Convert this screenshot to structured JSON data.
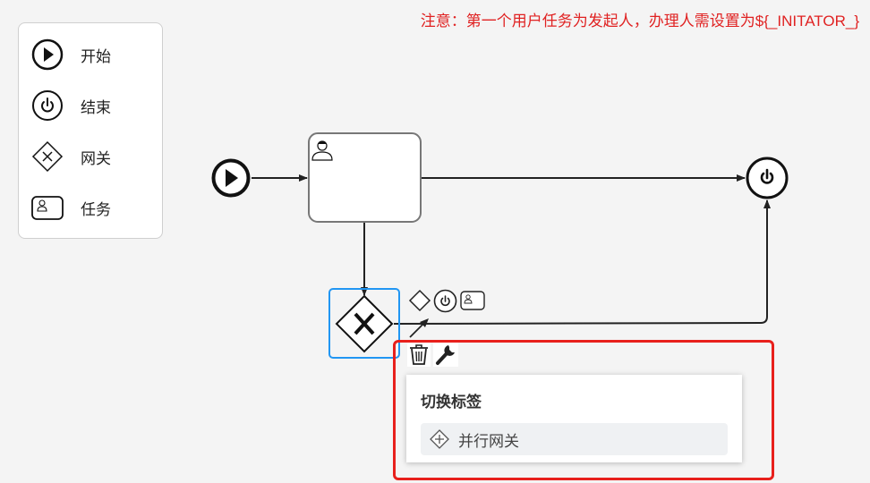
{
  "notice": "注意：第一个用户任务为发起人，办理人需设置为${_INITATOR_}",
  "palette": {
    "items": [
      {
        "label": "开始",
        "icon": "start-event-icon"
      },
      {
        "label": "结束",
        "icon": "end-event-icon"
      },
      {
        "label": "网关",
        "icon": "exclusive-gateway-icon"
      },
      {
        "label": "任务",
        "icon": "user-task-icon"
      }
    ]
  },
  "context_pad": {
    "icons": [
      "append-gateway-icon",
      "append-end-event-icon",
      "append-task-icon",
      "connect-arrow-icon",
      "delete-trash-icon",
      "change-type-wrench-icon"
    ]
  },
  "popup": {
    "title": "切换标签",
    "entries": [
      {
        "label": "并行网关",
        "icon": "parallel-gateway-icon"
      }
    ]
  },
  "colors": {
    "notice": "#e02222",
    "selection": "#2196f3",
    "highlight": "#e8201c",
    "stroke": "#222222"
  }
}
